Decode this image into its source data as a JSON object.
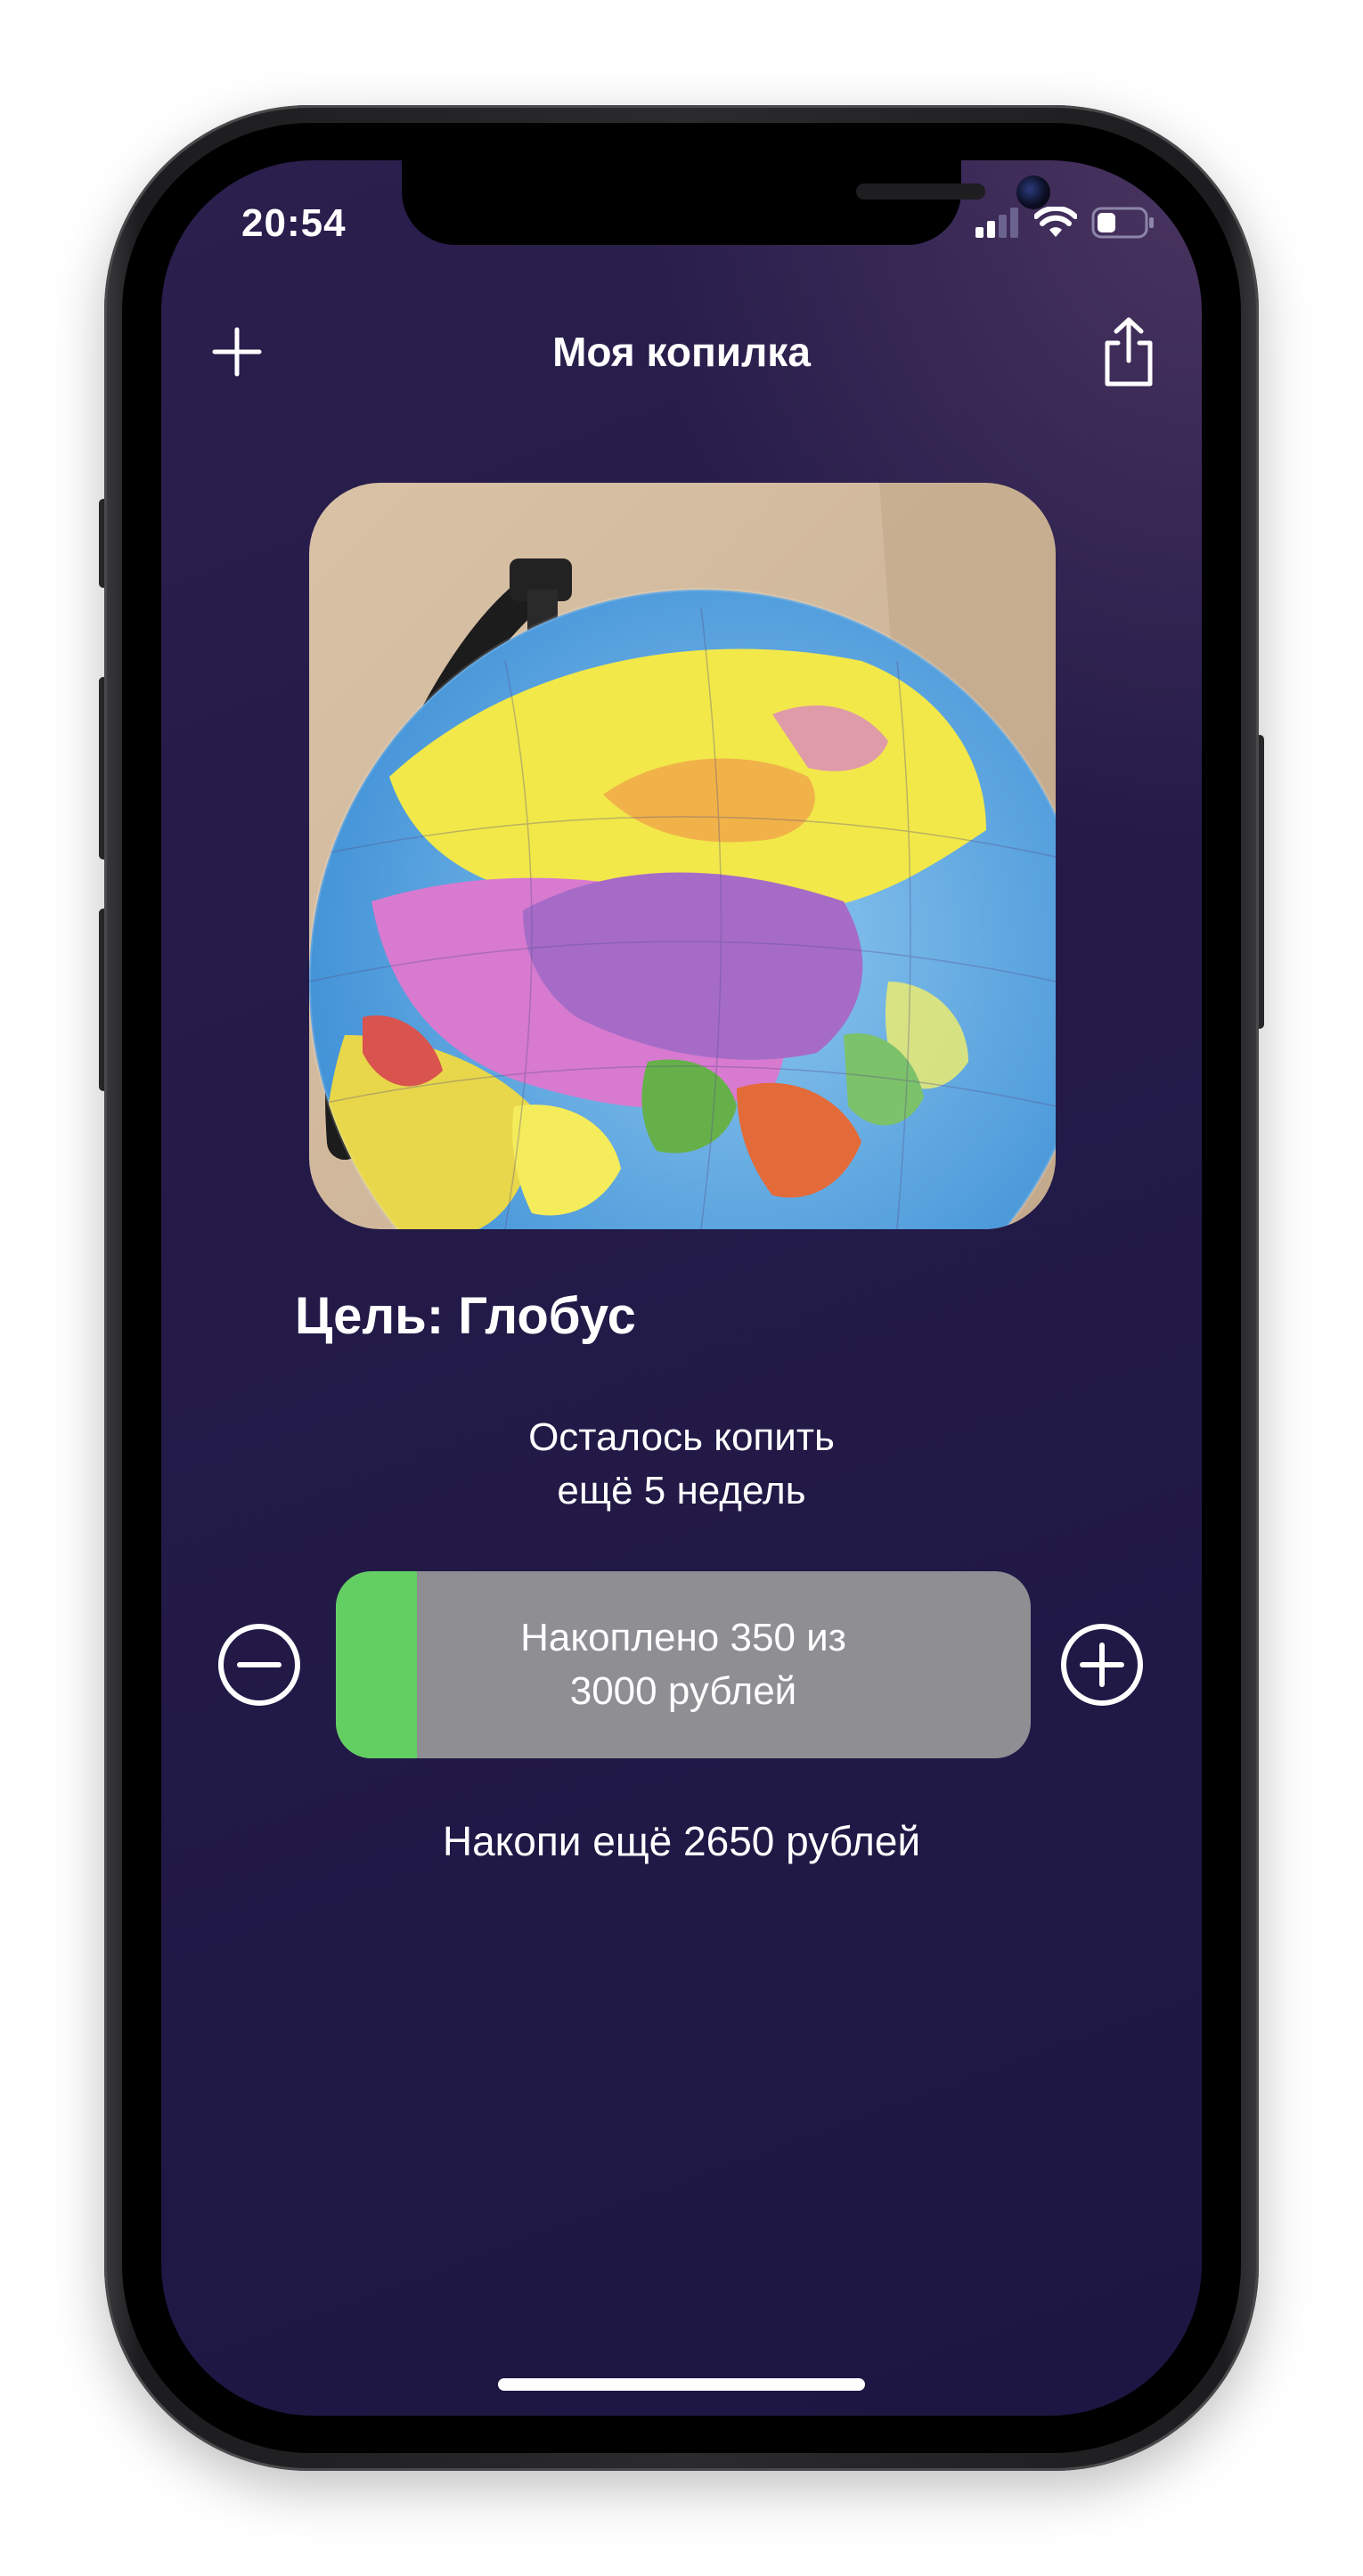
{
  "status_bar": {
    "time": "20:54",
    "icons": [
      "cellular-signal-icon",
      "wifi-icon",
      "battery-icon"
    ],
    "battery_level": 0.4
  },
  "nav": {
    "title": "Моя копилка",
    "add_icon": "plus-icon",
    "share_icon": "share-icon"
  },
  "goal": {
    "image_subject": "globe-photo",
    "title": "Цель: Глобус"
  },
  "remaining": {
    "line1": "Осталось копить",
    "line2": "ещё 5 недель"
  },
  "progress": {
    "saved": 350,
    "target": 3000,
    "fraction": 0.1167,
    "label_line1": "Накоплено 350 из",
    "label_line2": "3000 рублей",
    "minus_icon": "minus-circle-icon",
    "plus_icon": "plus-circle-icon"
  },
  "save_more": "Накопи ещё 2650 рублей",
  "colors": {
    "background_top": "#2a1f4d",
    "background_bottom": "#1d1642",
    "progress_fill": "#63cf63",
    "progress_track": "#8e8e93",
    "text": "#ffffff"
  }
}
